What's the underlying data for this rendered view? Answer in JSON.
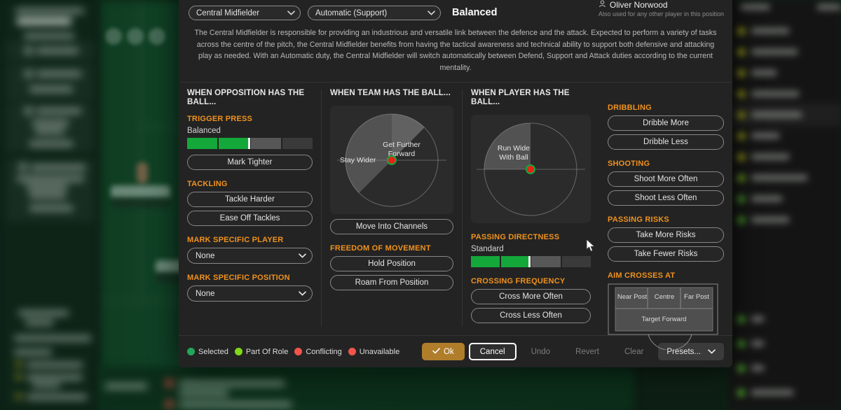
{
  "header": {
    "role_select": "Central Midfielder",
    "duty_select": "Automatic (Support)",
    "mentality": "Balanced",
    "player_name": "Oliver Norwood",
    "player_note": "Also used for any other player in this position",
    "player_icon": "person-icon",
    "description": "The Central Midfielder is responsible for providing an industrious and versatile link between the defence and the attack. Expected to perform a variety of tasks across the centre of the pitch, the Central Midfielder benefits from having the tactical awareness and technical ability to support both defensive and attacking play as needed. With an Automatic duty, the Central Midfielder will switch automatically between Defend, Support and Attack duties according to the current mentality."
  },
  "col_opposition": {
    "title": "WHEN OPPOSITION HAS THE BALL...",
    "trigger_press": {
      "heading": "TRIGGER PRESS",
      "value": "Balanced",
      "segments": [
        "on",
        "on",
        "mid",
        "off"
      ],
      "marker_after": 2
    },
    "mark_tighter": "Mark Tighter",
    "tackling": {
      "heading": "TACKLING",
      "tackle_harder": "Tackle Harder",
      "ease_off": "Ease Off Tackles"
    },
    "mark_player": {
      "heading": "MARK SPECIFIC PLAYER",
      "value": "None"
    },
    "mark_position": {
      "heading": "MARK SPECIFIC POSITION",
      "value": "None"
    }
  },
  "col_team": {
    "title": "WHEN TEAM HAS THE BALL...",
    "radial": {
      "label_top": "Get Further\nForward",
      "label_top_line1": "Get Further",
      "label_top_line2": "Forward",
      "label_left": "Stay Wider",
      "marker_color": "#e82315",
      "marker_ring": "#14a83b"
    },
    "move_into_channels": "Move Into Channels",
    "freedom": {
      "heading": "FREEDOM OF MOVEMENT",
      "hold_position": "Hold Position",
      "roam_from_position": "Roam From Position"
    }
  },
  "col_player": {
    "title": "WHEN PLAYER HAS THE BALL...",
    "radial": {
      "label_line1": "Run Wide",
      "label_line2": "With Ball",
      "marker_color": "#e82315",
      "marker_ring": "#14a83b"
    },
    "passing_directness": {
      "heading": "PASSING DIRECTNESS",
      "value": "Standard",
      "segments": [
        "on",
        "on",
        "mid",
        "off"
      ],
      "marker_after": 2
    },
    "crossing": {
      "heading": "CROSSING FREQUENCY",
      "cross_more": "Cross More Often",
      "cross_less": "Cross Less Often"
    }
  },
  "col_actions": {
    "dribbling": {
      "heading": "DRIBBLING",
      "more": "Dribble More",
      "less": "Dribble Less"
    },
    "shooting": {
      "heading": "SHOOTING",
      "more": "Shoot More Often",
      "less": "Shoot Less Often"
    },
    "passing_risks": {
      "heading": "PASSING RISKS",
      "more": "Take More Risks",
      "less": "Take Fewer Risks"
    },
    "aim_crosses": {
      "heading": "AIM CROSSES AT",
      "near_post": "Near Post",
      "centre": "Centre",
      "far_post": "Far Post",
      "target_forward": "Target Forward"
    }
  },
  "footer": {
    "legend": [
      {
        "label": "Selected",
        "color": "#22a65a"
      },
      {
        "label": "Part Of Role",
        "color": "#7fd81a"
      },
      {
        "label": "Conflicting",
        "color": "#f2544c"
      },
      {
        "label": "Unavailable",
        "color": "#f2544c"
      }
    ],
    "ok": "Ok",
    "ok_icon": "check-icon",
    "cancel": "Cancel",
    "undo": "Undo",
    "revert": "Revert",
    "clear": "Clear",
    "presets": "Presets..."
  },
  "colors": {
    "accent_orange": "#f0921e",
    "green_active": "#14a83b",
    "ok_button": "#b07d2b",
    "panel_bg": "#232323"
  }
}
